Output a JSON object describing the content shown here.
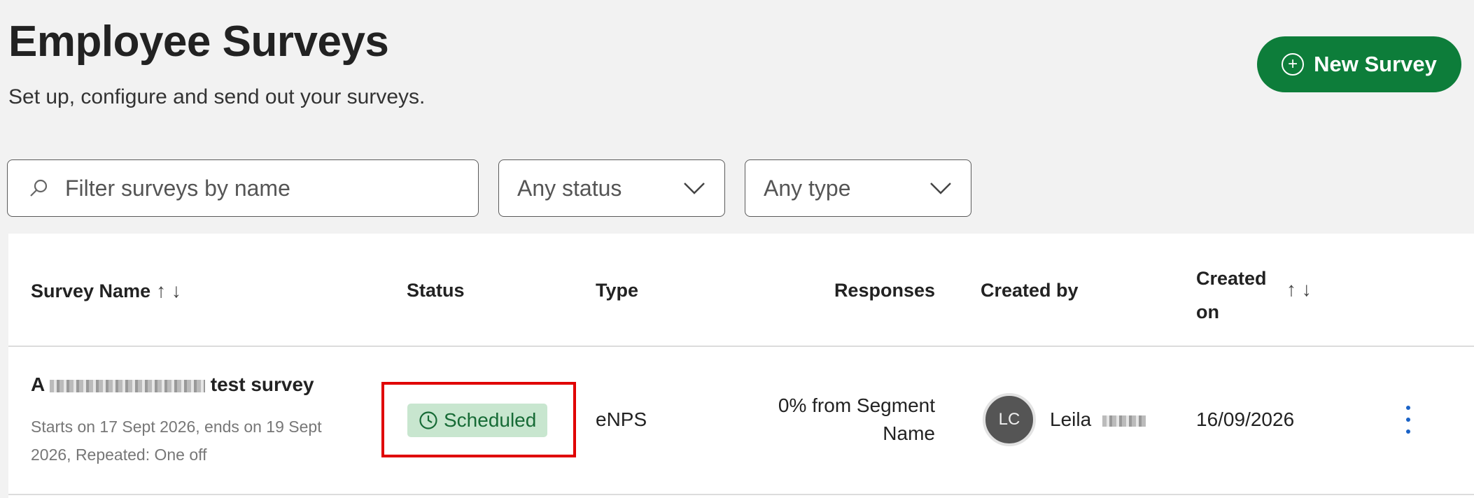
{
  "header": {
    "title": "Employee Surveys",
    "subtitle": "Set up, configure and send out your surveys.",
    "new_survey_label": "New Survey"
  },
  "filters": {
    "search_placeholder": "Filter surveys by name",
    "status_value": "Any status",
    "type_value": "Any type"
  },
  "table": {
    "columns": {
      "survey_name": "Survey Name",
      "status": "Status",
      "type": "Type",
      "responses": "Responses",
      "created_by": "Created by",
      "created_on_line1": "Created",
      "created_on_line2": "on"
    },
    "rows": [
      {
        "name_prefix": "A",
        "name_suffix": "test survey",
        "meta": "Starts on 17 Sept 2026, ends on 19 Sept 2026, Repeated: One off",
        "status": "Scheduled",
        "type": "eNPS",
        "responses": "0% from Segment Name",
        "creator_initials": "LC",
        "creator_name": "Leila",
        "created_on": "16/09/2026"
      }
    ]
  },
  "colors": {
    "primary_button": "#0d7d3a",
    "status_scheduled_bg": "#c8e6cf",
    "status_scheduled_text": "#176b36",
    "highlight": "#e00000"
  }
}
